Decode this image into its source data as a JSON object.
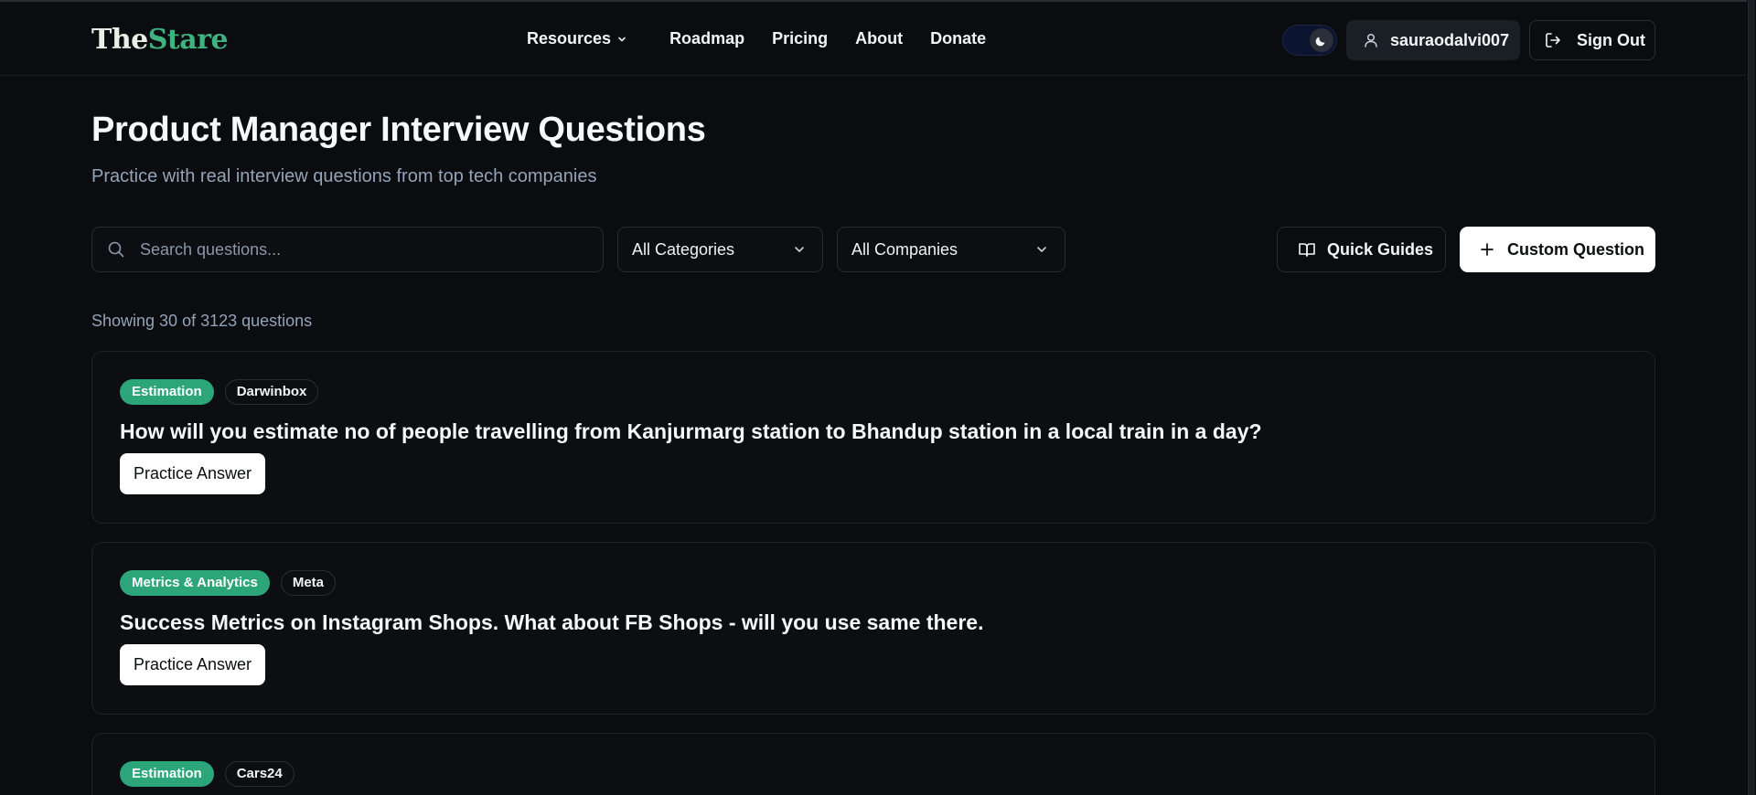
{
  "header": {
    "logo_part1": "The",
    "logo_part2": "Stare",
    "nav": {
      "resources": "Resources",
      "roadmap": "Roadmap",
      "pricing": "Pricing",
      "about": "About",
      "donate": "Donate"
    },
    "username": "sauraodalvi007",
    "sign_out": "Sign Out"
  },
  "page": {
    "title": "Product Manager Interview Questions",
    "subtitle": "Practice with real interview questions from top tech companies"
  },
  "filters": {
    "search_placeholder": "Search questions...",
    "category_selected": "All Categories",
    "company_selected": "All Companies",
    "quick_guides": "Quick Guides",
    "custom_question": "Custom Question"
  },
  "results_count": "Showing 30 of 3123 questions",
  "questions": [
    {
      "category": "Estimation",
      "company": "Darwinbox",
      "text": "How will you estimate no of people travelling from Kanjurmarg station to Bhandup station in a local train in a day?",
      "action": "Practice Answer"
    },
    {
      "category": "Metrics & Analytics",
      "company": "Meta",
      "text": "Success Metrics on Instagram Shops. What about FB Shops - will you use same there.",
      "action": "Practice Answer"
    },
    {
      "category": "Estimation",
      "company": "Cars24",
      "text": "",
      "action": ""
    }
  ],
  "colors": {
    "background": "#0a0c0f",
    "brand_green": "#3fb37f",
    "tag_green": "#2da57a",
    "muted_text": "#94a3b8"
  },
  "icons": [
    "chevron-down-icon",
    "moon-icon",
    "user-icon",
    "sign-out-icon",
    "search-icon",
    "book-icon",
    "plus-icon"
  ]
}
